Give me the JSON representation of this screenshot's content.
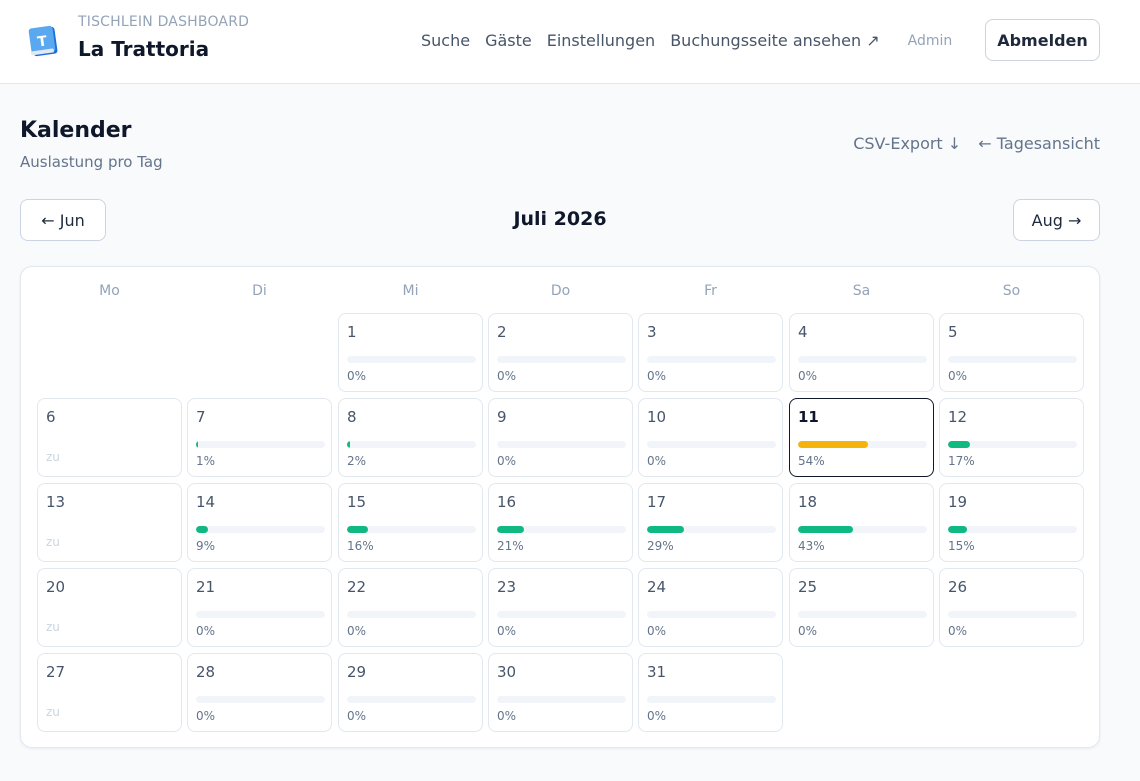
{
  "header": {
    "app_label": "TISCHLEIN DASHBOARD",
    "restaurant": "La Trattoria",
    "nav": [
      "Suche",
      "Gäste",
      "Einstellungen",
      "Buchungsseite ansehen ↗"
    ],
    "admin": "Admin",
    "logout": "Abmelden"
  },
  "page": {
    "title": "Kalender",
    "subtitle": "Auslastung pro Tag",
    "csv_export": "CSV-Export ↓",
    "day_view": "← Tagesansicht"
  },
  "month_nav": {
    "prev": "← Jun",
    "current": "Juli 2026",
    "next": "Aug →"
  },
  "calendar": {
    "weekdays": [
      "Mo",
      "Di",
      "Mi",
      "Do",
      "Fr",
      "Sa",
      "So"
    ],
    "first_weekday_index": 2,
    "closed_label": "zu",
    "today": 11,
    "colors": {
      "normal": "#10b981",
      "high": "#f5b40b",
      "track": "#f1f5f9"
    },
    "days": [
      {
        "day": "1",
        "pct": "0%",
        "value": 0
      },
      {
        "day": "2",
        "pct": "0%",
        "value": 0
      },
      {
        "day": "3",
        "pct": "0%",
        "value": 0
      },
      {
        "day": "4",
        "pct": "0%",
        "value": 0
      },
      {
        "day": "5",
        "pct": "0%",
        "value": 0
      },
      {
        "day": "6",
        "closed": true
      },
      {
        "day": "7",
        "pct": "1%",
        "value": 1
      },
      {
        "day": "8",
        "pct": "2%",
        "value": 2
      },
      {
        "day": "9",
        "pct": "0%",
        "value": 0
      },
      {
        "day": "10",
        "pct": "0%",
        "value": 0
      },
      {
        "day": "11",
        "pct": "54%",
        "value": 54,
        "high": true
      },
      {
        "day": "12",
        "pct": "17%",
        "value": 17
      },
      {
        "day": "13",
        "closed": true
      },
      {
        "day": "14",
        "pct": "9%",
        "value": 9
      },
      {
        "day": "15",
        "pct": "16%",
        "value": 16
      },
      {
        "day": "16",
        "pct": "21%",
        "value": 21
      },
      {
        "day": "17",
        "pct": "29%",
        "value": 29
      },
      {
        "day": "18",
        "pct": "43%",
        "value": 43
      },
      {
        "day": "19",
        "pct": "15%",
        "value": 15
      },
      {
        "day": "20",
        "closed": true
      },
      {
        "day": "21",
        "pct": "0%",
        "value": 0
      },
      {
        "day": "22",
        "pct": "0%",
        "value": 0
      },
      {
        "day": "23",
        "pct": "0%",
        "value": 0
      },
      {
        "day": "24",
        "pct": "0%",
        "value": 0
      },
      {
        "day": "25",
        "pct": "0%",
        "value": 0
      },
      {
        "day": "26",
        "pct": "0%",
        "value": 0
      },
      {
        "day": "27",
        "closed": true
      },
      {
        "day": "28",
        "pct": "0%",
        "value": 0
      },
      {
        "day": "29",
        "pct": "0%",
        "value": 0
      },
      {
        "day": "30",
        "pct": "0%",
        "value": 0
      },
      {
        "day": "31",
        "pct": "0%",
        "value": 0
      }
    ]
  }
}
